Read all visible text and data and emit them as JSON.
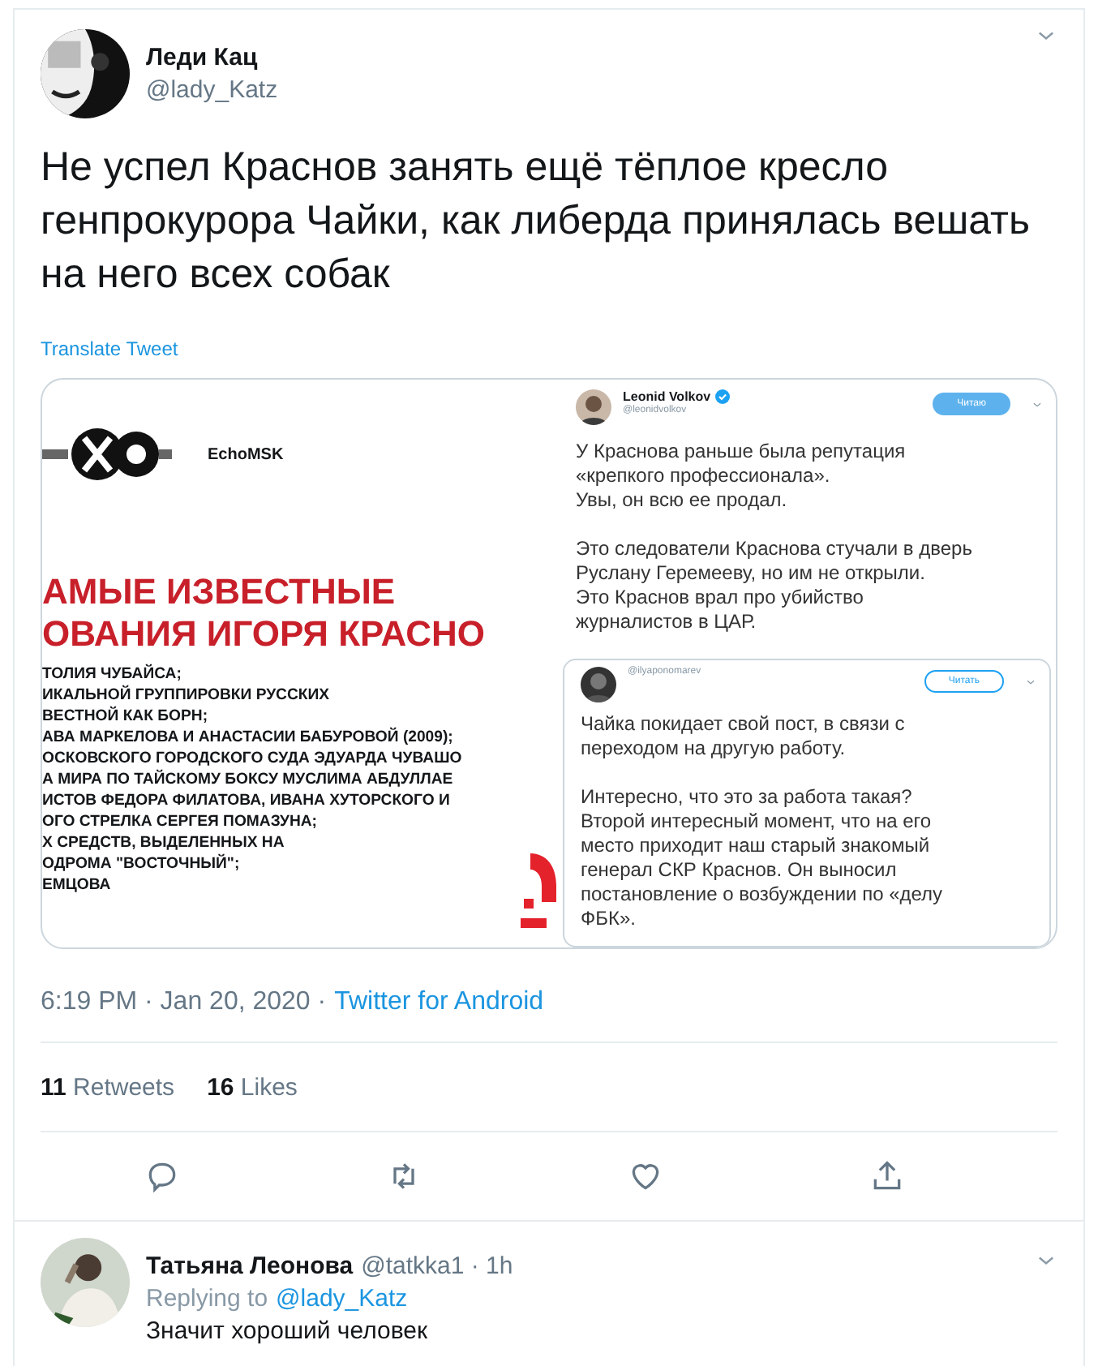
{
  "tweet": {
    "author": {
      "name": "Леди Кац",
      "handle": "@lady_Katz"
    },
    "text": "Не успел Краснов занять ещё тёплое кресло генпрокурора Чайки, как либерда принялась вешать на него всех собак",
    "translate_link": "Translate Tweet",
    "media": {
      "echo_card": {
        "brand": "EchoMSK",
        "headline_lines": [
          "АМЫЕ ИЗВЕСТНЫЕ",
          "ОВАНИЯ ИГОРЯ КРАСНО"
        ],
        "list_lines": [
          "ТОЛИЯ ЧУБАЙСА;",
          "ИКАЛЬНОЙ ГРУППИРОВКИ РУССКИХ",
          "ВЕСТНОЙ КАК БОРН;",
          "АВА МАРКЕЛОВА И АНАСТАСИИ БАБУРОВОЙ (2009);",
          "ОСКОВСКОГО ГОРОДСКОГО СУДА ЭДУАРДА ЧУВАШО",
          "А МИРА ПО ТАЙСКОМУ БОКСУ МУСЛИМА АБДУЛЛАЕ",
          "ИСТОВ ФЕДОРА ФИЛАТОВА, ИВАНА ХУТОРСКОГО И",
          "ОГО СТРЕЛКА СЕРГЕЯ ПОМАЗУНА;",
          "Х СРЕДСТВ, ВЫДЕЛЕННЫХ НА",
          "ОДРОМА \"ВОСТОЧНЫЙ\";",
          "ЕМЦОВА"
        ]
      },
      "quoted_tweets": [
        {
          "name": "Leonid Volkov",
          "verified": true,
          "handle": "@leonidvolkov",
          "follow_button": "Читаю",
          "following": true,
          "paragraphs": [
            "У Краснова раньше была репутация\n«крепкого профессионала».\nУвы, он всю ее продал.",
            "Это следователи Краснова стучали в дверь\nРуслану Геремееву, но им не открыли.\nЭто Краснов врал про убийство\nжурналистов в ЦАР."
          ]
        },
        {
          "handle": "@ilyaponomarev",
          "follow_button": "Читать",
          "following": false,
          "paragraphs": [
            "Чайка покидает свой пост, в связи с\nпереходом на другую работу.",
            "Интересно, что это за работа такая?\nВторой интересный момент, что на его\nместо приходит наш старый знакомый\nгенерал СКР Краснов. Он выносил\nпостановление о возбуждении по «делу\nФБК»."
          ]
        }
      ]
    },
    "timestamp": "6:19 PM · Jan 20, 2020 ·",
    "source": "Twitter for Android",
    "stats": [
      {
        "count": "11",
        "label": "Retweets"
      },
      {
        "count": "16",
        "label": "Likes"
      }
    ],
    "actions": [
      {
        "kind": "reply"
      },
      {
        "kind": "retweet"
      },
      {
        "kind": "like"
      },
      {
        "kind": "share"
      }
    ]
  },
  "reply": {
    "name": "Татьяна Леонова",
    "meta": "@tatkka1 · 1h",
    "replying_label": "Replying to",
    "replying_to": "@lady_Katz",
    "text": "Значит хороший человек"
  }
}
